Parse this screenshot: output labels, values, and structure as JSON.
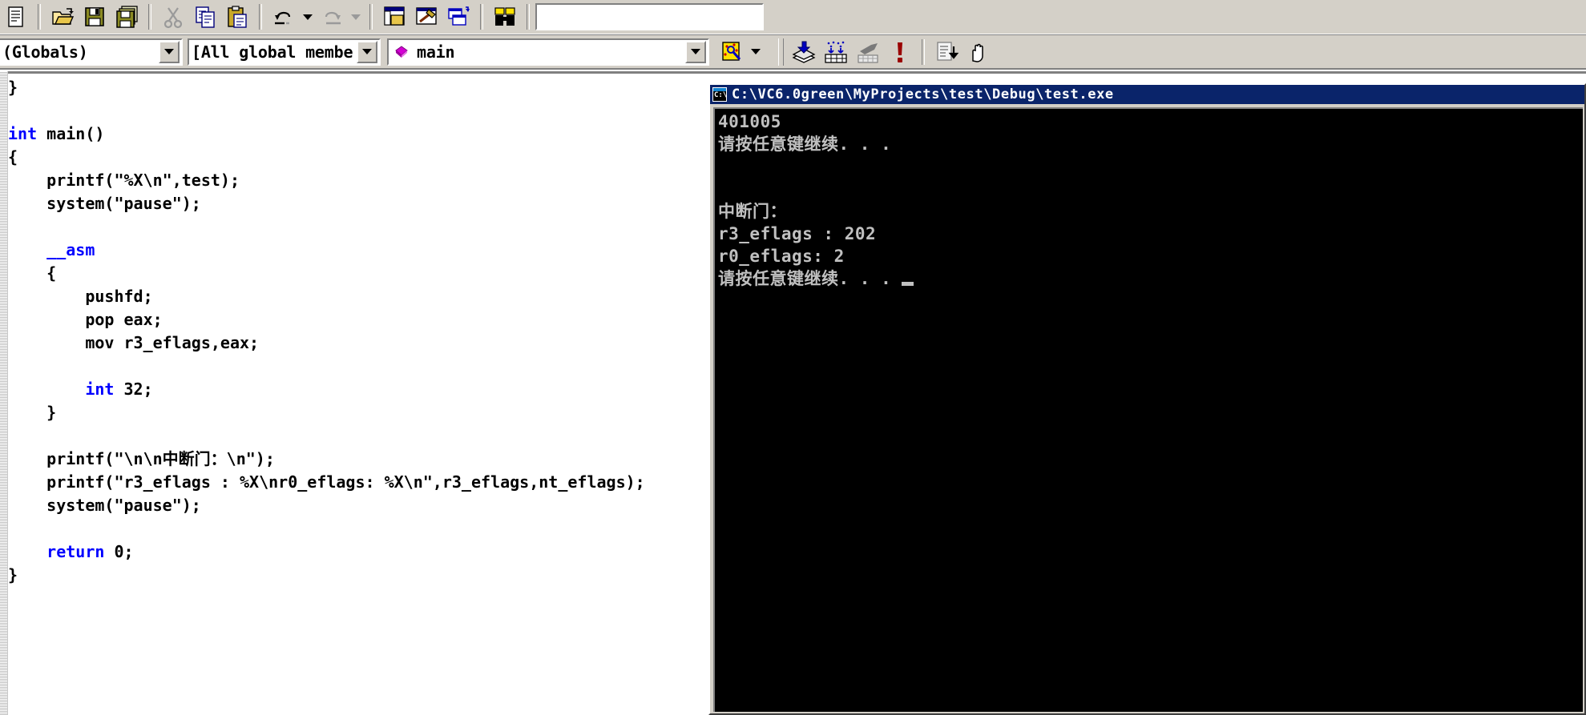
{
  "app": {
    "name": "Microsoft Visual C++ 6.0",
    "theme_bg": "#d4d0c8",
    "accent": "#0a246a"
  },
  "toolbar_standard": {
    "name": "Standard toolbar",
    "buttons": [
      {
        "id": "new-text-file",
        "label": "New Text File",
        "icon": "document-icon"
      },
      {
        "id": "open",
        "label": "Open",
        "icon": "open-folder-icon"
      },
      {
        "id": "save",
        "label": "Save",
        "icon": "floppy-disk-icon"
      },
      {
        "id": "save-all",
        "label": "Save All",
        "icon": "save-all-icon"
      },
      {
        "id": "cut",
        "label": "Cut",
        "icon": "scissors-icon"
      },
      {
        "id": "copy",
        "label": "Copy",
        "icon": "copy-pages-icon"
      },
      {
        "id": "paste",
        "label": "Paste",
        "icon": "clipboard-icon"
      },
      {
        "id": "undo",
        "label": "Undo",
        "icon": "undo-arrow-icon"
      },
      {
        "id": "redo",
        "label": "Redo",
        "icon": "redo-arrow-icon"
      },
      {
        "id": "workspace",
        "label": "Workspace",
        "icon": "workspace-window-icon"
      },
      {
        "id": "output",
        "label": "Output",
        "icon": "output-hammer-icon"
      },
      {
        "id": "window-list",
        "label": "Window List",
        "icon": "window-list-icon"
      },
      {
        "id": "find-in-files",
        "label": "Find in Files",
        "icon": "binoculars-icon"
      }
    ],
    "find_box": {
      "value": "",
      "placeholder": ""
    }
  },
  "toolbar_wizardbar": {
    "name": "WizardBar",
    "class_combo": {
      "value": "(Globals)"
    },
    "filter_combo": {
      "value": "[All global members"
    },
    "member_combo": {
      "value": "main",
      "icon": "member-diamond-icon",
      "icon_color": "#d400d4"
    },
    "action_button": {
      "label": "WizardBar Actions",
      "icon": "wizard-magnify-icon"
    },
    "buttons": [
      {
        "id": "compile",
        "label": "Compile",
        "icon": "compile-stack-icon"
      },
      {
        "id": "build",
        "label": "Build",
        "icon": "build-bricks-icon"
      },
      {
        "id": "stop-build",
        "label": "Stop Build",
        "icon": "stop-build-icon"
      },
      {
        "id": "execute-program",
        "label": "Execute Program",
        "icon": "exclamation-icon"
      },
      {
        "id": "go",
        "label": "Go",
        "icon": "debug-go-icon"
      },
      {
        "id": "insert-remove-breakpoint",
        "label": "Insert/Remove Breakpoint",
        "icon": "hand-icon"
      }
    ]
  },
  "editor": {
    "name": "source-code-editor",
    "filename_hint": "",
    "lines": [
      [
        {
          "t": "}",
          "k": false
        }
      ],
      [
        {
          "t": "",
          "k": false
        }
      ],
      [
        {
          "t": "int",
          "k": true
        },
        {
          "t": " main()",
          "k": false
        }
      ],
      [
        {
          "t": "{",
          "k": false
        }
      ],
      [
        {
          "t": "    printf(\"%X\\n\",test);",
          "k": false
        }
      ],
      [
        {
          "t": "    system(\"pause\");",
          "k": false
        }
      ],
      [
        {
          "t": "",
          "k": false
        }
      ],
      [
        {
          "t": "    ",
          "k": false
        },
        {
          "t": "__asm",
          "k": true
        }
      ],
      [
        {
          "t": "    {",
          "k": false
        }
      ],
      [
        {
          "t": "        pushfd;",
          "k": false
        }
      ],
      [
        {
          "t": "        pop eax;",
          "k": false
        }
      ],
      [
        {
          "t": "        mov r3_eflags,eax;",
          "k": false
        }
      ],
      [
        {
          "t": "",
          "k": false
        }
      ],
      [
        {
          "t": "        ",
          "k": false
        },
        {
          "t": "int",
          "k": true
        },
        {
          "t": " 32;",
          "k": false
        }
      ],
      [
        {
          "t": "    }",
          "k": false
        }
      ],
      [
        {
          "t": "",
          "k": false
        }
      ],
      [
        {
          "t": "    printf(\"\\n\\n中断门：\\n\");",
          "k": false
        }
      ],
      [
        {
          "t": "    printf(\"r3_eflags : %X\\nr0_eflags: %X\\n\",r3_eflags,nt_eflags);",
          "k": false
        }
      ],
      [
        {
          "t": "    system(\"pause\");",
          "k": false
        }
      ],
      [
        {
          "t": "",
          "k": false
        }
      ],
      [
        {
          "t": "    ",
          "k": false
        },
        {
          "t": "return",
          "k": true
        },
        {
          "t": " 0;",
          "k": false
        }
      ],
      [
        {
          "t": "}",
          "k": false
        }
      ]
    ]
  },
  "console": {
    "name": "console-window",
    "title": "C:\\VC6.0green\\MyProjects\\test\\Debug\\test.exe",
    "icon": "console-cmd-icon",
    "output": "401005\n请按任意键继续. . .\n\n\n中断门：\nr3_eflags : 202\nr0_eflags: 2\n请按任意键继续. . . ",
    "lines": [
      "401005",
      "请按任意键继续. . .",
      "",
      "",
      "中断门：",
      "r3_eflags : 202",
      "r0_eflags: 2",
      "请按任意键继续. . . "
    ],
    "values": {
      "test_hex": "401005",
      "r3_eflags": "202",
      "r0_eflags": "2"
    },
    "cursor_visible": true
  }
}
